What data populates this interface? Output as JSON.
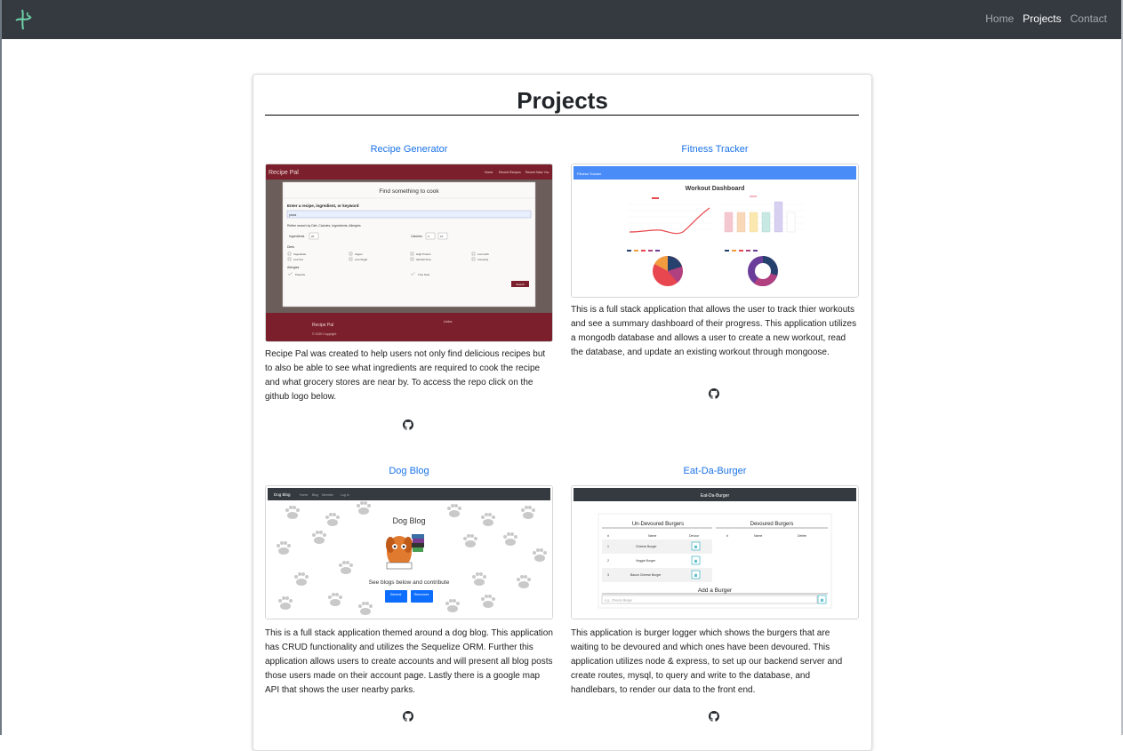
{
  "nav": {
    "links": [
      "Home",
      "Projects",
      "Contact"
    ],
    "active": "Projects"
  },
  "page": {
    "title": "Projects"
  },
  "projects": [
    {
      "title": "Recipe Generator",
      "description": "Recipe Pal was created to help users not only find delicious recipes but to also be able to see what ingredients are required to cook the recipe and what grocery stores are near by. To access the repo click on the github logo below.",
      "thumb": {
        "brand": "Recipe Pal",
        "nav_links": [
          "Home",
          "Recent Recipes",
          "Recent Near You"
        ],
        "modal_title": "Find something to cook",
        "search_label": "Enter a recipe, ingredient, or keyword",
        "search_value": "pizza",
        "refine_label": "Refine search by Diet, Calories, Ingredients, Allergies",
        "ingredients_label": "Ingredients",
        "ingredients_value": "20",
        "calories_label": "Calories",
        "calories_min": "0",
        "calories_max": "10",
        "diets_label": "Diets",
        "diets": [
          "Vegetarian",
          "Vegan",
          "High Protein",
          "Low Carb",
          "Low Fat",
          "Low Sugar",
          "Alcohol Free",
          "Immunity"
        ],
        "allergies_label": "Allergies",
        "allergies": [
          "Peanuts",
          "Tree Nuts"
        ],
        "button": "Search",
        "footer_brand": "Recipe Pal",
        "footer_links_title": "Links",
        "copyright": "© 2020 Copyright"
      }
    },
    {
      "title": "Fitness Tracker",
      "description": "This is a full stack application that allows the user to track thier workouts and see a summary dashboard of their progress. This application utilizes a mongodb database and allows a user to create a new workout, read the database, and update an existing workout through mongoose.",
      "thumb": {
        "bar_title": "Fitness Tracker",
        "dashboard_title": "Workout Dashboard"
      }
    },
    {
      "title": "Dog Blog",
      "description": "This is a full stack application themed around a dog blog. This application has CRUD functionality and utilizes the Sequelize ORM. Further this application allows users to create accounts and will present all blog posts those users made on their account page. Lastly there is a google map API that shows the user nearby parks.",
      "thumb": {
        "brand": "Dog Blog",
        "nav_links": [
          "Home",
          "Blog",
          "Member",
          "Log In"
        ],
        "heading": "Dog Blog",
        "tagline": "See blogs below and contribute",
        "buttons": [
          "General",
          "Resources"
        ]
      }
    },
    {
      "title": "Eat-Da-Burger",
      "description": "This application is burger logger which shows the burgers that are waiting to be devoured and which ones have been devoured. This application utilizes node & express, to set up our backend server and create routes, mysql, to query and write to the database, and handlebars, to render our data to the front end.",
      "thumb": {
        "header": "Eat-Da-Burger",
        "undevoured_title": "Un-Devoured Burgers",
        "devoured_title": "Devoured Burgers",
        "columns_left": [
          "#",
          "Name",
          "Devour"
        ],
        "columns_right": [
          "#",
          "Name",
          "Delete"
        ],
        "rows": [
          {
            "num": "1",
            "name": "Cheese Burger"
          },
          {
            "num": "2",
            "name": "Veggie Burger"
          },
          {
            "num": "3",
            "name": "Bacon Cheese Burger"
          }
        ],
        "add_title": "Add a Burger",
        "add_placeholder": "e.g., Cheese Burger"
      }
    }
  ],
  "colors": {
    "navbar": "#343a40",
    "link": "#1a73e8",
    "recipe_maroon": "#7a1f2b",
    "fitness_blue": "#4a8cf7",
    "button_blue": "#0d6efd"
  },
  "icons": {
    "github": "github-icon",
    "logo": "logo-icon"
  }
}
